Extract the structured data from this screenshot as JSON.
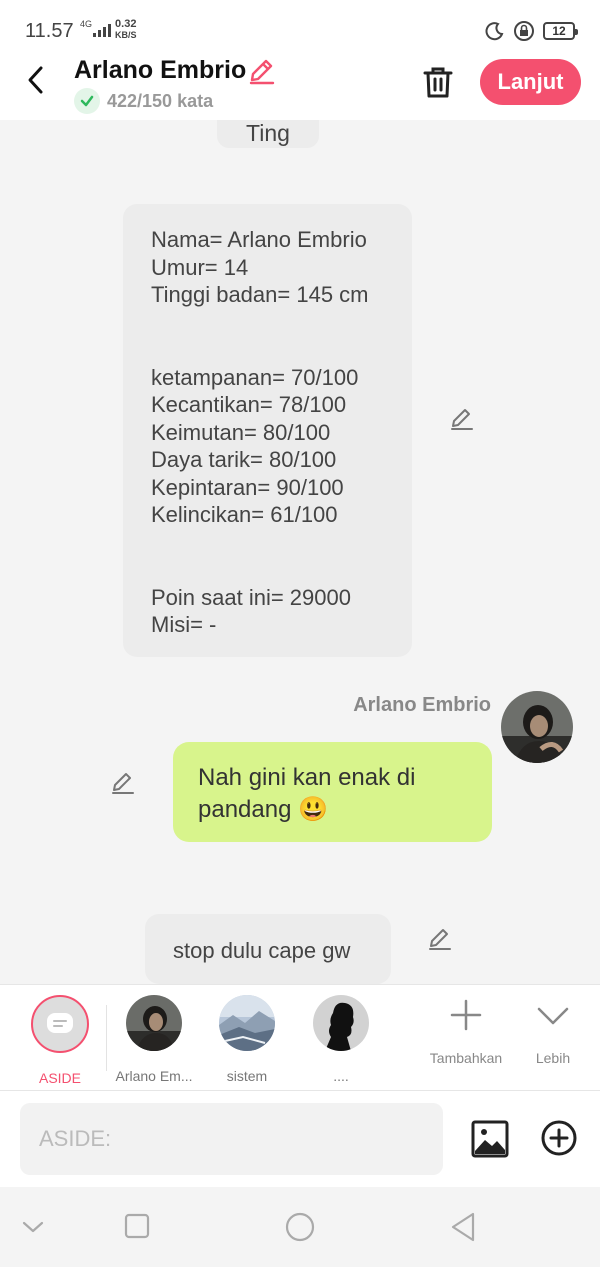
{
  "status_bar": {
    "time": "11.57",
    "network": "4G",
    "speed_value": "0.32",
    "speed_unit": "KB/S",
    "battery": "12"
  },
  "header": {
    "title": "Arlano Embrio",
    "word_count": "422/150 kata",
    "next_label": "Lanjut"
  },
  "messages": {
    "previous_fragment": "Ting",
    "stats_lines": [
      "Nama= Arlano Embrio",
      "Umur= 14",
      "Tinggi badan= 145 cm",
      "",
      "",
      "ketampanan= 70/100",
      "Kecantikan= 78/100",
      "Keimutan= 80/100",
      "Daya tarik= 80/100",
      "Kepintaran= 90/100",
      "Kelincikan= 61/100",
      "",
      "",
      "Poin saat ini= 29000",
      "Misi= -"
    ],
    "sender_name": "Arlano Embrio",
    "green_text": "Nah gini kan enak di pandang 😃",
    "stop_text": "stop dulu cape gw"
  },
  "characters": [
    {
      "label": "ASIDE",
      "icon": "aside-icon"
    },
    {
      "label": "Arlano Em...",
      "icon": "avatar-arlano"
    },
    {
      "label": "sistem",
      "icon": "avatar-sistem"
    },
    {
      "label": "....",
      "icon": "avatar-silhouette"
    }
  ],
  "tools": {
    "add_label": "Tambahkan",
    "more_label": "Lebih"
  },
  "input": {
    "placeholder": "ASIDE:"
  },
  "colors": {
    "accent": "#f4506f",
    "user_bubble": "#d8f48c",
    "system_bubble": "#ececec"
  }
}
